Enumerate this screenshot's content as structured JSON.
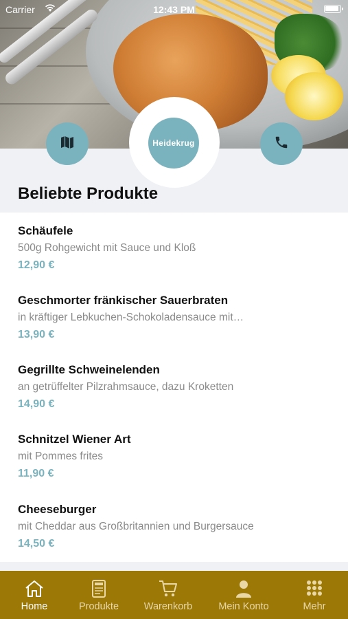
{
  "status_bar": {
    "carrier": "Carrier",
    "time": "12:43 PM"
  },
  "header": {
    "logo_text": "Heidekrug",
    "left_button_icon": "map-icon",
    "right_button_icon": "phone-icon"
  },
  "section_title": "Beliebte Produkte",
  "products": [
    {
      "name": "Schäufele",
      "description": "500g Rohgewicht mit Sauce und Kloß",
      "price": "12,90 €"
    },
    {
      "name": "Geschmorter fränkischer Sauerbraten",
      "description": "in kräftiger Lebkuchen-Schokoladensauce mit…",
      "price": "13,90 €"
    },
    {
      "name": "Gegrillte Schweinelenden",
      "description": "an getrüffelter Pilzrahmsauce, dazu Kroketten",
      "price": "14,90 €"
    },
    {
      "name": "Schnitzel Wiener Art",
      "description": "mit Pommes frites",
      "price": "11,90 €"
    },
    {
      "name": "Cheeseburger",
      "description": "mit Cheddar aus Großbritannien und Burgersauce",
      "price": "14,50 €"
    }
  ],
  "tabs": [
    {
      "label": "Home",
      "icon": "home-icon",
      "active": true
    },
    {
      "label": "Produkte",
      "icon": "menu-card-icon",
      "active": false
    },
    {
      "label": "Warenkorb",
      "icon": "cart-icon",
      "active": false
    },
    {
      "label": "Mein Konto",
      "icon": "person-icon",
      "active": false
    },
    {
      "label": "Mehr",
      "icon": "grid-icon",
      "active": false
    }
  ],
  "colors": {
    "accent": "#7ab3be",
    "tabbar": "#9c7807",
    "tab_inactive": "#e9d7a6"
  }
}
